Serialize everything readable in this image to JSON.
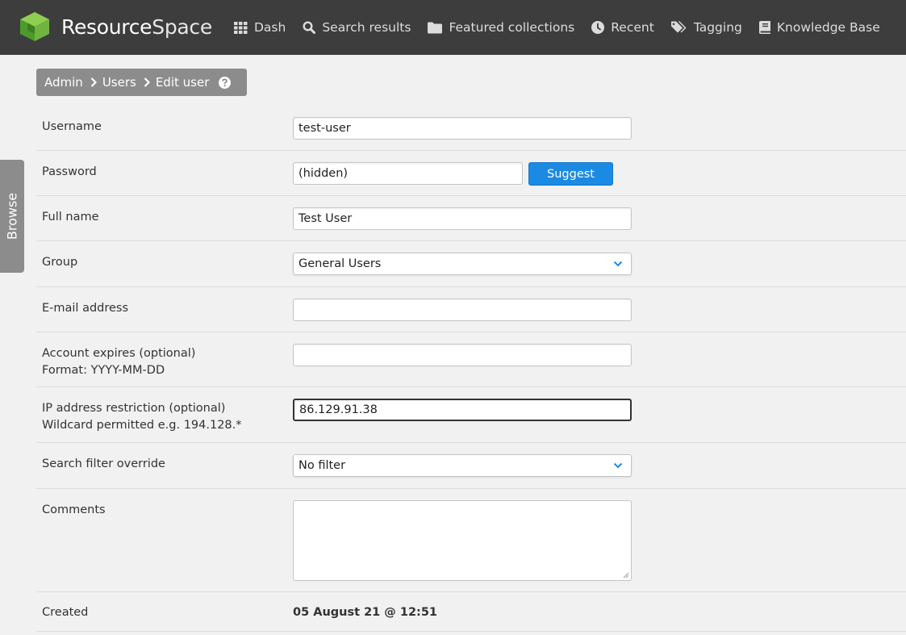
{
  "header": {
    "logo_text_a": "Resource",
    "logo_text_b": "Space",
    "nav": [
      {
        "label": "Dash",
        "icon": "grid-icon"
      },
      {
        "label": "Search results",
        "icon": "search-icon"
      },
      {
        "label": "Featured collections",
        "icon": "folder-icon"
      },
      {
        "label": "Recent",
        "icon": "clock-icon"
      },
      {
        "label": "Tagging",
        "icon": "tags-icon"
      },
      {
        "label": "Knowledge Base",
        "icon": "book-icon"
      }
    ]
  },
  "breadcrumb": {
    "items": [
      "Admin",
      "Users",
      "Edit user"
    ]
  },
  "browse_tab": {
    "label": "Browse"
  },
  "form": {
    "username": {
      "label": "Username",
      "value": "test-user"
    },
    "password": {
      "label": "Password",
      "value": "(hidden)",
      "suggest_label": "Suggest"
    },
    "fullname": {
      "label": "Full name",
      "value": "Test User"
    },
    "group": {
      "label": "Group",
      "value": "General Users"
    },
    "email": {
      "label": "E-mail address",
      "value": ""
    },
    "expires": {
      "label": "Account expires (optional)",
      "hint": "Format: YYYY-MM-DD",
      "value": ""
    },
    "ip": {
      "label": "IP address restriction (optional)",
      "hint": "Wildcard permitted e.g. 194.128.*",
      "value": "86.129.91.38"
    },
    "search_filter": {
      "label": "Search filter override",
      "value": "No filter"
    },
    "comments": {
      "label": "Comments",
      "value": ""
    },
    "created": {
      "label": "Created",
      "value": "05 August 21 @ 12:51"
    }
  },
  "colors": {
    "header_bg": "#3d3d3d",
    "accent_blue": "#1b8ae3",
    "logo_green": "#6fb43f",
    "breadcrumb_bg": "#8c8c8c"
  }
}
